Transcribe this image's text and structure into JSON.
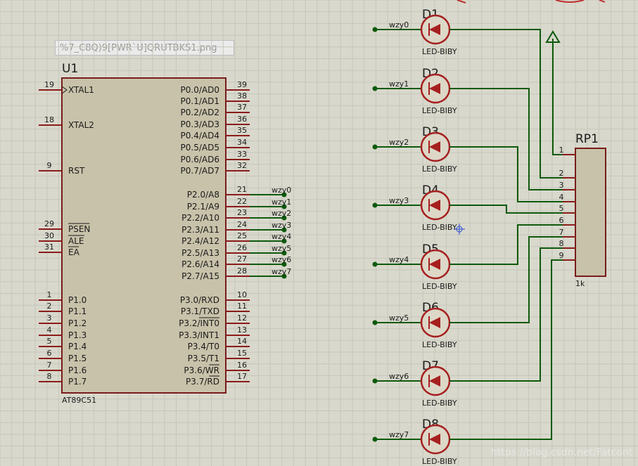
{
  "file_label": "%7_C8Q)9[PWR`U]QRUTBKS1.png",
  "watermark": "https://blog.csdn.net/Fatcont",
  "colors": {
    "background": "#d8d8cc",
    "grid": "#c6c6ba",
    "body_fill": "#c9c2aa",
    "outline": "#7a1c1c",
    "wire": "#0d5a0d",
    "pin": "#8b1a1a",
    "text": "#1a1a1a"
  },
  "u1": {
    "ref": "U1",
    "part": "AT89C51",
    "left_pins": [
      {
        "num": "19",
        "name": "XTAL1",
        "clock": true
      },
      {
        "num": "18",
        "name": "XTAL2"
      },
      {
        "num": "9",
        "name": "RST"
      },
      {
        "num": "29",
        "name": "PSEN",
        "overline": true
      },
      {
        "num": "30",
        "name": "ALE",
        "overline": true
      },
      {
        "num": "31",
        "name": "EA",
        "overline": true
      },
      {
        "num": "1",
        "name": "P1.0"
      },
      {
        "num": "2",
        "name": "P1.1"
      },
      {
        "num": "3",
        "name": "P1.2"
      },
      {
        "num": "4",
        "name": "P1.3"
      },
      {
        "num": "5",
        "name": "P1.4"
      },
      {
        "num": "6",
        "name": "P1.5"
      },
      {
        "num": "7",
        "name": "P1.6"
      },
      {
        "num": "8",
        "name": "P1.7"
      }
    ],
    "right_pins": [
      {
        "num": "39",
        "name": "P0.0/AD0"
      },
      {
        "num": "38",
        "name": "P0.1/AD1"
      },
      {
        "num": "37",
        "name": "P0.2/AD2"
      },
      {
        "num": "36",
        "name": "P0.3/AD3"
      },
      {
        "num": "35",
        "name": "P0.4/AD4"
      },
      {
        "num": "34",
        "name": "P0.5/AD5"
      },
      {
        "num": "33",
        "name": "P0.6/AD6"
      },
      {
        "num": "32",
        "name": "P0.7/AD7"
      },
      {
        "num": "21",
        "name": "P2.0/A8",
        "net": "wzy0"
      },
      {
        "num": "22",
        "name": "P2.1/A9",
        "net": "wzy1"
      },
      {
        "num": "23",
        "name": "P2.2/A10",
        "net": "wzy2"
      },
      {
        "num": "24",
        "name": "P2.3/A11",
        "net": "wzy3"
      },
      {
        "num": "25",
        "name": "P2.4/A12",
        "net": "wzy4"
      },
      {
        "num": "26",
        "name": "P2.5/A13",
        "net": "wzy5"
      },
      {
        "num": "27",
        "name": "P2.6/A14",
        "net": "wzy6"
      },
      {
        "num": "28",
        "name": "P2.7/A15",
        "net": "wzy7"
      },
      {
        "num": "10",
        "name": "P3.0/RXD"
      },
      {
        "num": "11",
        "name": "P3.1/TXD"
      },
      {
        "num": "12",
        "name": "P3.2/",
        "over": "INT0"
      },
      {
        "num": "13",
        "name": "P3.3/INT1"
      },
      {
        "num": "14",
        "name": "P3.4/T0"
      },
      {
        "num": "15",
        "name": "P3.5/T1"
      },
      {
        "num": "16",
        "name": "P3.6/",
        "over": "WR"
      },
      {
        "num": "17",
        "name": "P3.7/",
        "over": "RD"
      }
    ]
  },
  "leds": [
    {
      "ref": "D1",
      "value": "LED-BIBY",
      "net": "wzy0"
    },
    {
      "ref": "D2",
      "value": "LED-BIBY",
      "net": "wzy1"
    },
    {
      "ref": "D3",
      "value": "LED-BIBY",
      "net": "wzy2"
    },
    {
      "ref": "D4",
      "value": "LED-BIBY",
      "net": "wzy3"
    },
    {
      "ref": "D5",
      "value": "LED-BIBY",
      "net": "wzy4"
    },
    {
      "ref": "D6",
      "value": "LED-BIBY",
      "net": "wzy5"
    },
    {
      "ref": "D7",
      "value": "LED-BIBY",
      "net": "wzy6"
    },
    {
      "ref": "D8",
      "value": "LED-BIBY",
      "net": "wzy7"
    }
  ],
  "rp1": {
    "ref": "RP1",
    "value": "1k",
    "pins": [
      "1",
      "2",
      "3",
      "4",
      "5",
      "6",
      "7",
      "8",
      "9"
    ]
  }
}
